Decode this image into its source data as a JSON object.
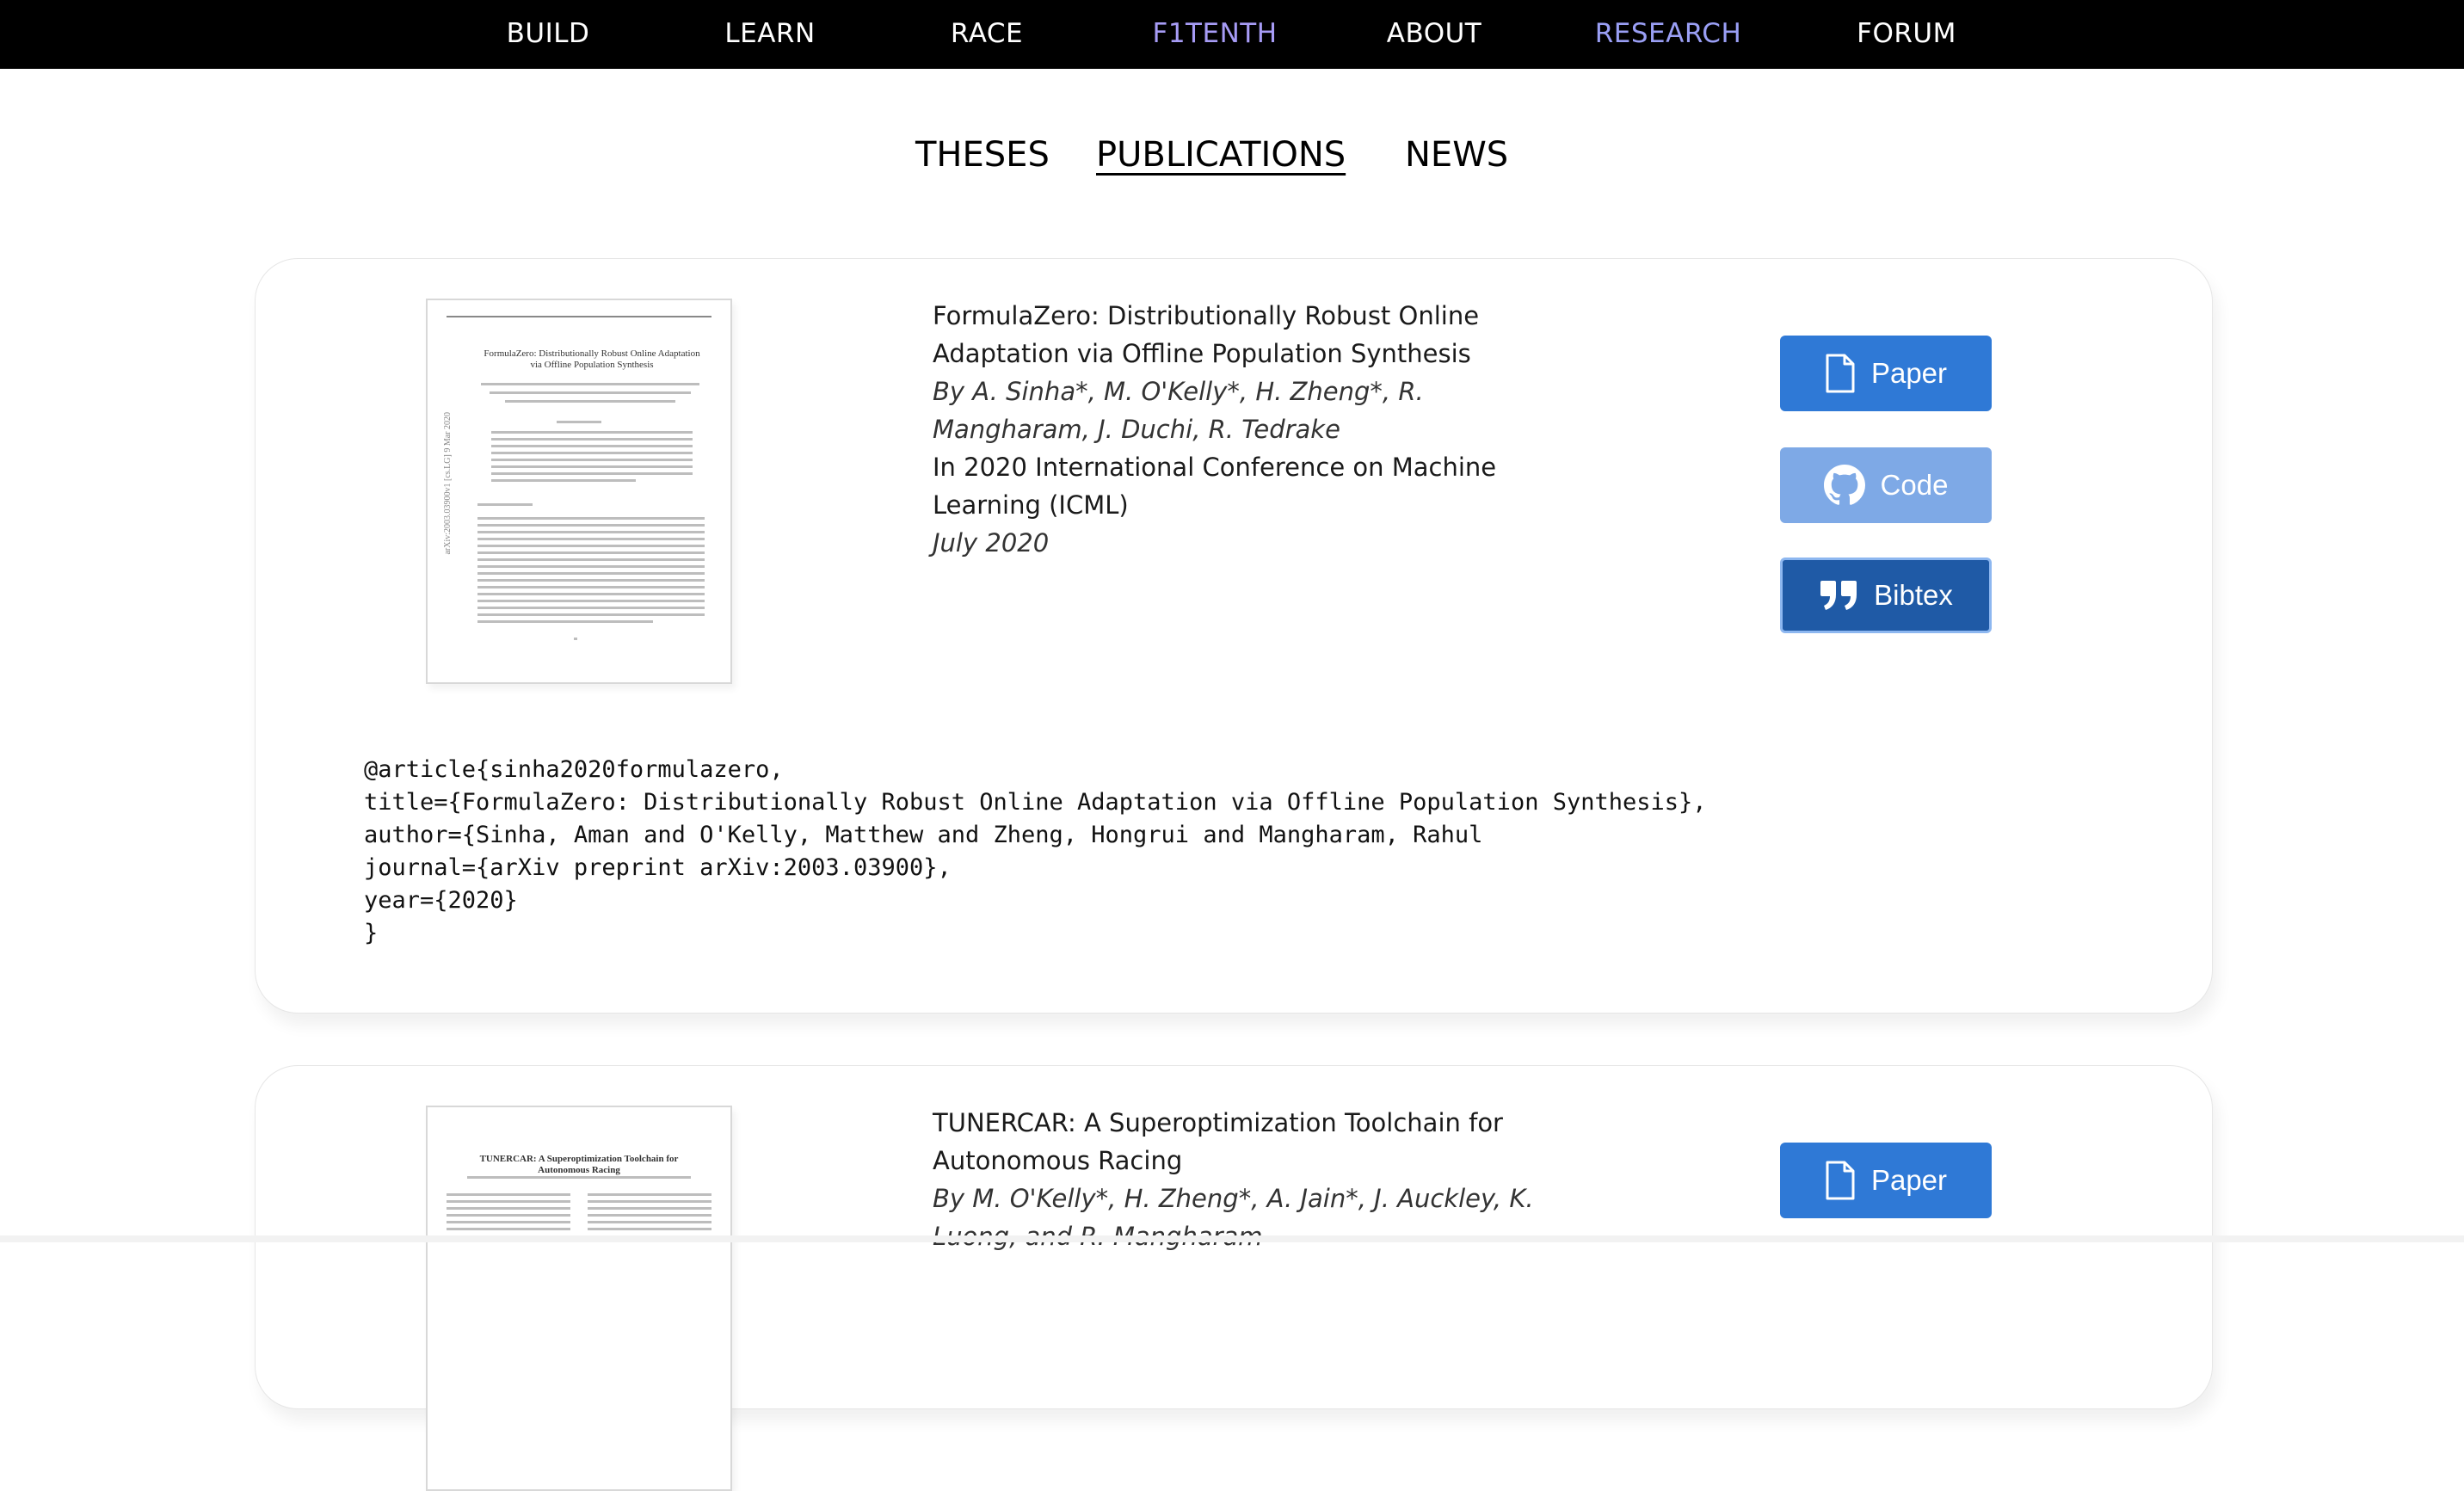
{
  "nav": {
    "items": [
      {
        "label": "BUILD"
      },
      {
        "label": "LEARN"
      },
      {
        "label": "RACE"
      },
      {
        "label": "F1TENTH"
      },
      {
        "label": "ABOUT"
      },
      {
        "label": "RESEARCH"
      },
      {
        "label": "FORUM"
      }
    ],
    "accent_color": "#a79cf6"
  },
  "subtabs": {
    "items": [
      {
        "label": "THESES"
      },
      {
        "label": "PUBLICATIONS"
      },
      {
        "label": "NEWS"
      }
    ],
    "active": "PUBLICATIONS"
  },
  "publications": [
    {
      "title": "FormulaZero: Distributionally Robust Online Adaptation via Offline Population Synthesis",
      "authors": "By A. Sinha*, M. O'Kelly*, H. Zheng*, R. Mangharam, J. Duchi, R. Tedrake",
      "venue": "In 2020 International Conference on Machine Learning (ICML)",
      "date": "July 2020",
      "thumb_title": "FormulaZero: Distributionally Robust Online Adaptation via Offline Population Synthesis",
      "thumb_side": "arXiv:2003.03900v1 [cs.LG] 9 Mar 2020",
      "buttons": {
        "paper": "Paper",
        "code": "Code",
        "bibtex": "Bibtex"
      },
      "bibtex": "@article{sinha2020formulazero,\ntitle={FormulaZero: Distributionally Robust Online Adaptation via Offline Population Synthesis},\nauthor={Sinha, Aman and O'Kelly, Matthew and Zheng, Hongrui and Mangharam, Rahul\njournal={arXiv preprint arXiv:2003.03900},\nyear={2020}\n}"
    },
    {
      "title": "TUNERCAR: A Superoptimization Toolchain for Autonomous Racing",
      "authors": "By M. O'Kelly*, H. Zheng*, A. Jain*, J. Auckley, K. Luong, and R. Mangharam",
      "thumb_title": "TUNERCAR: A Superoptimization Toolchain for Autonomous Racing",
      "buttons": {
        "paper": "Paper"
      }
    }
  ],
  "colors": {
    "paper_button": "#2f79d6",
    "code_button": "#7ea9e6",
    "bibtex_button": "#1f5aa6"
  }
}
